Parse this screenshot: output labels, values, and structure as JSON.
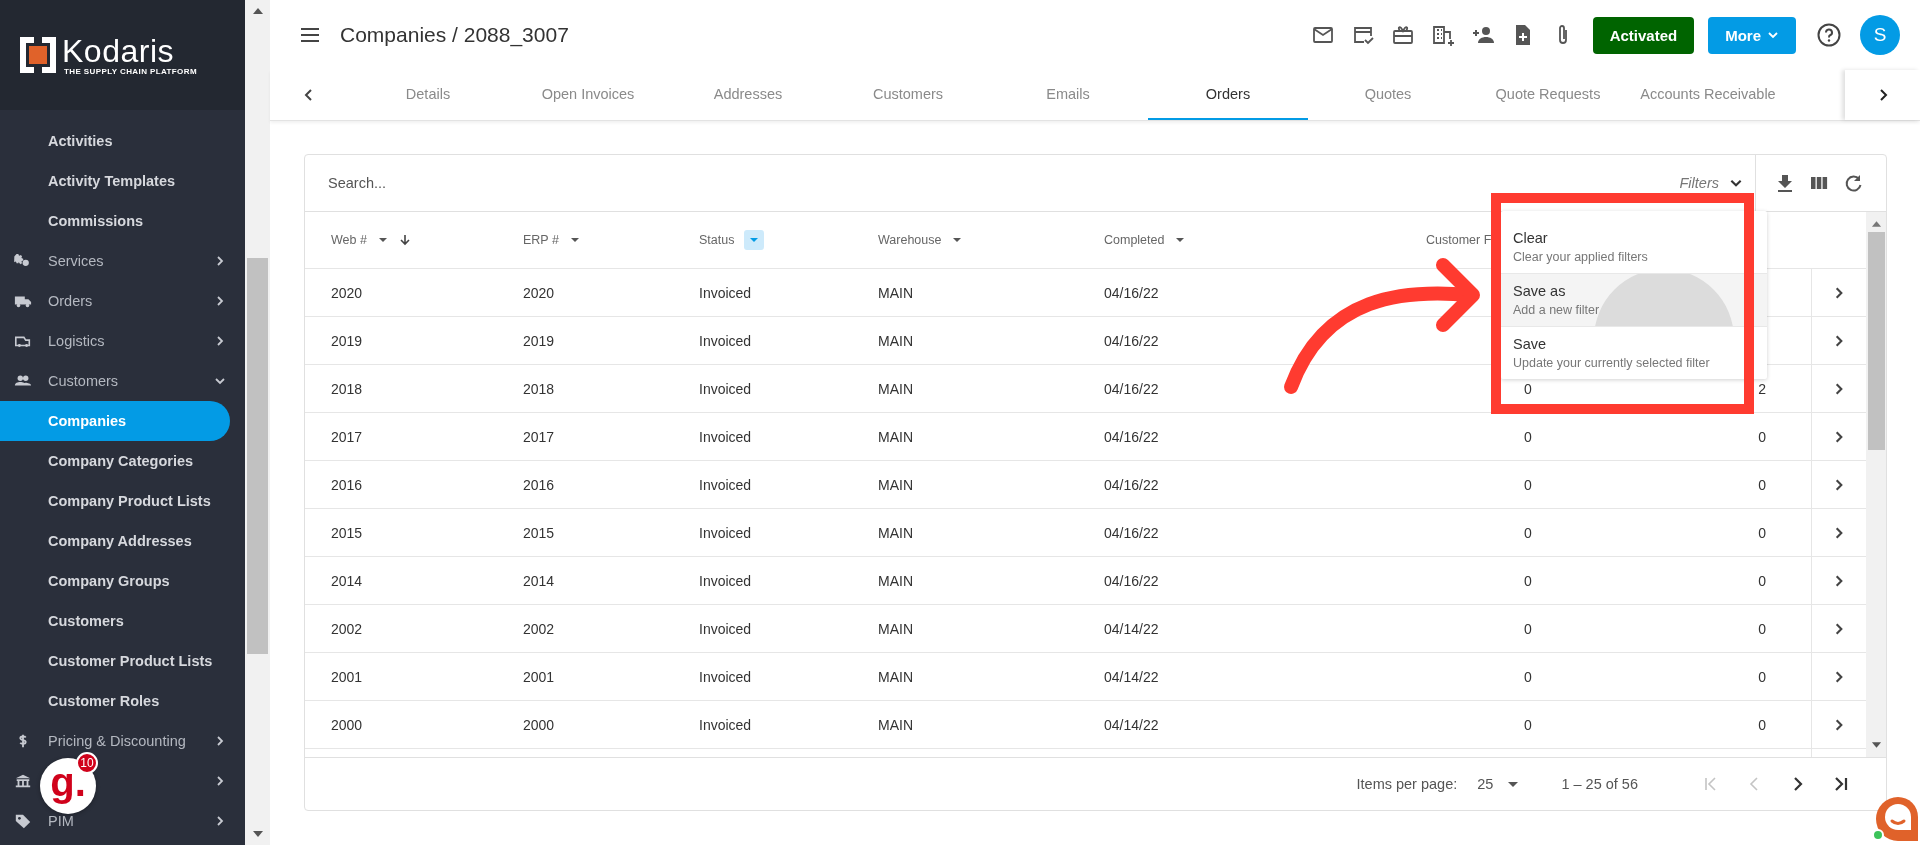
{
  "sidebar": {
    "logo": {
      "name": "Kodaris",
      "tagline": "THE SUPPLY CHAIN PLATFORM"
    },
    "items": [
      {
        "label": "Activities",
        "kind": "link",
        "selected": false
      },
      {
        "label": "Activity Templates",
        "kind": "link",
        "selected": false
      },
      {
        "label": "Commissions",
        "kind": "link",
        "selected": false
      },
      {
        "label": "Services",
        "kind": "group",
        "selected": false,
        "expanded": false
      },
      {
        "label": "Orders",
        "kind": "group",
        "selected": false,
        "expanded": false
      },
      {
        "label": "Logistics",
        "kind": "group",
        "selected": false,
        "expanded": false
      },
      {
        "label": "Customers",
        "kind": "group",
        "selected": false,
        "expanded": true
      },
      {
        "label": "Companies",
        "kind": "link",
        "selected": true
      },
      {
        "label": "Company Categories",
        "kind": "link",
        "selected": false
      },
      {
        "label": "Company Product Lists",
        "kind": "link",
        "selected": false
      },
      {
        "label": "Company Addresses",
        "kind": "link",
        "selected": false
      },
      {
        "label": "Company Groups",
        "kind": "link",
        "selected": false
      },
      {
        "label": "Customers",
        "kind": "link",
        "selected": false
      },
      {
        "label": "Customer Product Lists",
        "kind": "link",
        "selected": false
      },
      {
        "label": "Customer Roles",
        "kind": "link",
        "selected": false
      },
      {
        "label": "Pricing & Discounting",
        "kind": "group",
        "selected": false,
        "expanded": false
      },
      {
        "kind": "group",
        "selected": false,
        "expanded": false
      },
      {
        "label": "PIM",
        "kind": "group",
        "selected": false,
        "expanded": false
      }
    ],
    "widget": {
      "letter": "g.",
      "count": "10"
    }
  },
  "header": {
    "title": "Companies / 2088_3007",
    "status_button": "Activated",
    "more_button": "More",
    "avatar": "S"
  },
  "tabs": [
    {
      "label": "Details",
      "selected": false
    },
    {
      "label": "Open Invoices",
      "selected": false
    },
    {
      "label": "Addresses",
      "selected": false
    },
    {
      "label": "Customers",
      "selected": false
    },
    {
      "label": "Emails",
      "selected": false
    },
    {
      "label": "Orders",
      "selected": true
    },
    {
      "label": "Quotes",
      "selected": false
    },
    {
      "label": "Quote Requests",
      "selected": false
    },
    {
      "label": "Accounts Receivable",
      "selected": false
    }
  ],
  "table": {
    "search": {
      "placeholder": "Search..."
    },
    "filters_label": "Filters",
    "columns": [
      {
        "label": "Web #",
        "has_menu": true,
        "filtered": false,
        "sorted": true
      },
      {
        "label": "ERP #",
        "has_menu": true,
        "filtered": false,
        "sorted": false
      },
      {
        "label": "Status",
        "has_menu": true,
        "filtered": true,
        "sorted": false
      },
      {
        "label": "Warehouse",
        "has_menu": true,
        "filtered": false,
        "sorted": false
      },
      {
        "label": "Completed",
        "has_menu": true,
        "filtered": false,
        "sorted": false
      },
      {
        "label": "Customer F",
        "has_menu": false,
        "sorted": false
      }
    ],
    "rows": [
      {
        "cells": [
          "2020",
          "2020",
          "Invoiced",
          "MAIN",
          "04/16/22"
        ]
      },
      {
        "cells": [
          "2019",
          "2019",
          "Invoiced",
          "MAIN",
          "04/16/22"
        ]
      },
      {
        "cells": [
          "2018",
          "2018",
          "Invoiced",
          "MAIN",
          "04/16/22",
          "0",
          "2"
        ]
      },
      {
        "cells": [
          "2017",
          "2017",
          "Invoiced",
          "MAIN",
          "04/16/22",
          "0",
          "0"
        ]
      },
      {
        "cells": [
          "2016",
          "2016",
          "Invoiced",
          "MAIN",
          "04/16/22",
          "0",
          "0"
        ]
      },
      {
        "cells": [
          "2015",
          "2015",
          "Invoiced",
          "MAIN",
          "04/16/22",
          "0",
          "0"
        ]
      },
      {
        "cells": [
          "2014",
          "2014",
          "Invoiced",
          "MAIN",
          "04/16/22",
          "0",
          "0"
        ]
      },
      {
        "cells": [
          "2002",
          "2002",
          "Invoiced",
          "MAIN",
          "04/14/22",
          "0",
          "0"
        ]
      },
      {
        "cells": [
          "2001",
          "2001",
          "Invoiced",
          "MAIN",
          "04/14/22",
          "0",
          "0"
        ]
      },
      {
        "cells": [
          "2000",
          "2000",
          "Invoiced",
          "MAIN",
          "04/14/22",
          "0",
          "0"
        ]
      }
    ],
    "filter_menu": [
      {
        "title": "Clear",
        "description": "Clear your applied filters",
        "highlighted": false
      },
      {
        "title": "Save as",
        "description": "Add a new filter",
        "highlighted": true
      },
      {
        "title": "Save",
        "description": "Update your currently selected filter",
        "highlighted": false
      }
    ],
    "pagination": {
      "label": "Items per page:",
      "page_size": "25",
      "range": "1 – 25 of 56",
      "nav": [
        {
          "disabled": true
        },
        {
          "disabled": true
        },
        {
          "disabled": false
        },
        {
          "disabled": false
        }
      ]
    }
  }
}
